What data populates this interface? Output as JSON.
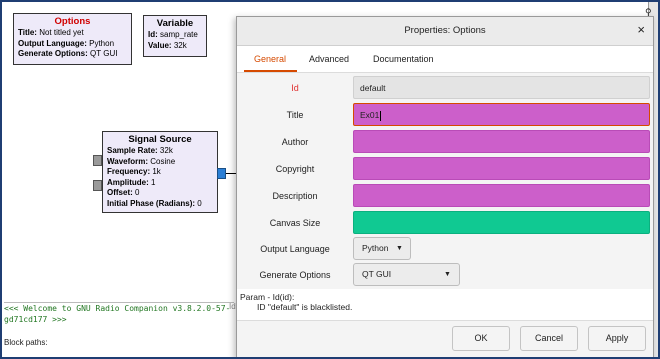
{
  "canvas": {
    "options_block": {
      "title": "Options",
      "rows": [
        {
          "key": "Title:",
          "value": "Not titled yet"
        },
        {
          "key": "Output Language:",
          "value": "Python"
        },
        {
          "key": "Generate Options:",
          "value": "QT GUI"
        }
      ]
    },
    "variable_block": {
      "title": "Variable",
      "rows": [
        {
          "key": "Id:",
          "value": "samp_rate"
        },
        {
          "key": "Value:",
          "value": "32k"
        }
      ]
    },
    "signal_source_block": {
      "title": "Signal Source",
      "rows": [
        {
          "key": "Sample Rate:",
          "value": "32k"
        },
        {
          "key": "Waveform:",
          "value": "Cosine"
        },
        {
          "key": "Frequency:",
          "value": "1k"
        },
        {
          "key": "Amplitude:",
          "value": "1"
        },
        {
          "key": "Offset:",
          "value": "0"
        },
        {
          "key": "Initial Phase (Radians):",
          "value": "0"
        }
      ]
    }
  },
  "console": {
    "line1": "<<< Welcome to GNU Radio Companion v3.8.2.0-57-",
    "line2": "gd71cd177 >>>",
    "block_paths": "Block paths:",
    "side_text": "Id"
  },
  "dialog": {
    "title": "Properties: Options",
    "close_glyph": "×",
    "tabs": [
      "General",
      "Advanced",
      "Documentation"
    ],
    "active_tab": "General",
    "params": [
      {
        "label": "Id",
        "value": "default",
        "style": "plain",
        "label_color": "red"
      },
      {
        "label": "Title",
        "value": "Ex01",
        "style": "magenta",
        "focused": true
      },
      {
        "label": "Author",
        "value": "",
        "style": "magenta"
      },
      {
        "label": "Copyright",
        "value": "",
        "style": "magenta"
      },
      {
        "label": "Description",
        "value": "",
        "style": "magenta"
      },
      {
        "label": "Canvas Size",
        "value": "",
        "style": "teal"
      },
      {
        "label": "Output Language",
        "value": "Python",
        "style": "select"
      },
      {
        "label": "Generate Options",
        "value": "QT GUI",
        "style": "select"
      }
    ],
    "message": {
      "line1": "Param - Id(id):",
      "line2": "ID \"default\" is blacklisted."
    },
    "buttons": {
      "ok": "OK",
      "cancel": "Cancel",
      "apply": "Apply"
    }
  },
  "colors": {
    "accent": "#d64a00",
    "magenta_field": "#cc5fca",
    "teal_field": "#10c992",
    "error_label": "#e03030",
    "block_fill": "#eeeaf9",
    "port_out": "#2b7fd6"
  },
  "icons": {
    "dropdown": "▼",
    "close": "×"
  }
}
